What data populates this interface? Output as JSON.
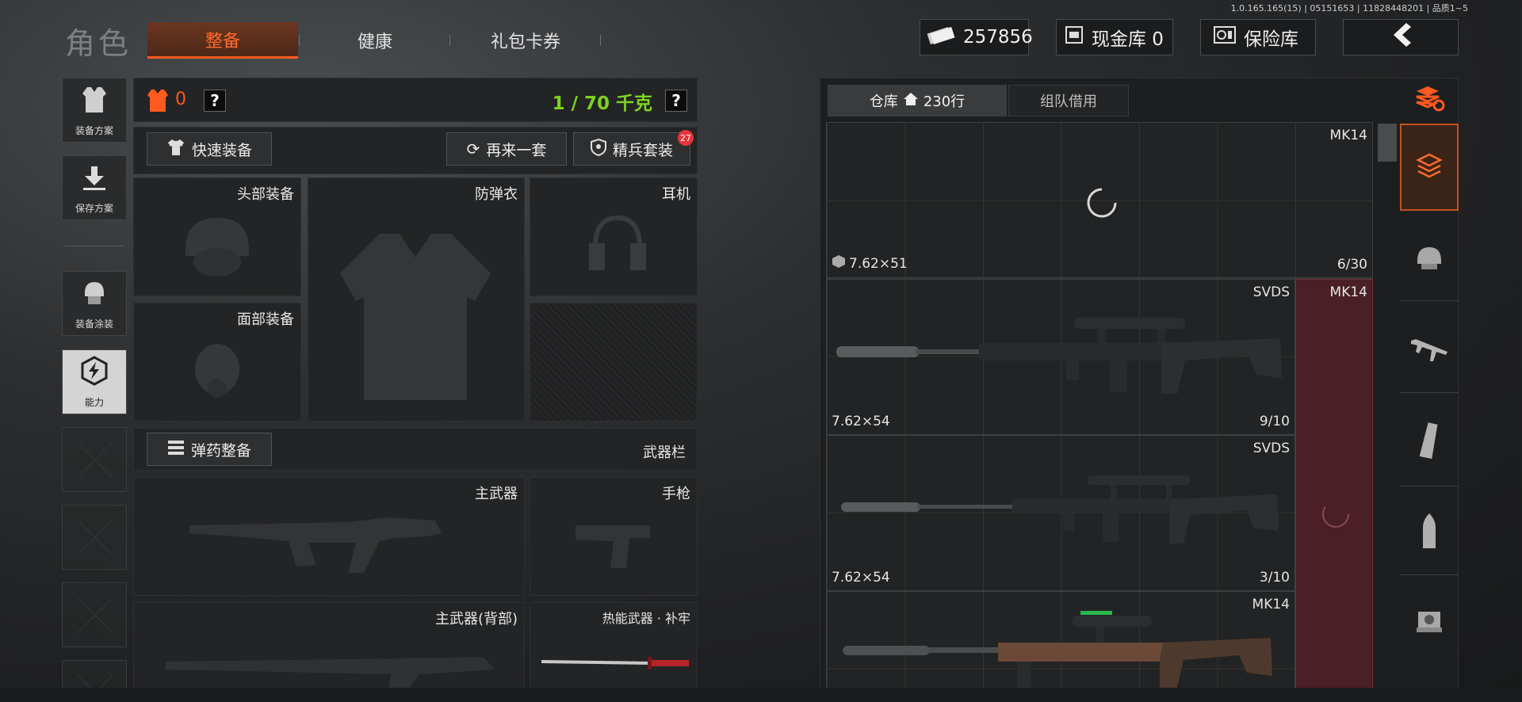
{
  "version": "1.0.165.165(15) | 05151653 | 11828448201 | 品质1~5",
  "header": {
    "title": "角色",
    "tabs": [
      {
        "label": "整备",
        "active": true
      },
      {
        "label": "健康",
        "active": false
      },
      {
        "label": "礼包卡券",
        "active": false
      }
    ],
    "currency": "257856",
    "cash_vault": "现金库 0",
    "safe": "保险库",
    "back_icon": "chevron-left-icon"
  },
  "left_nav": [
    {
      "label": "装备方案",
      "icon": "vest-icon"
    },
    {
      "label": "保存方案",
      "icon": "download-icon"
    },
    {
      "label": "装备涂装",
      "icon": "helmet-paint-icon"
    },
    {
      "label": "能力",
      "icon": "lightning-icon",
      "active": true
    }
  ],
  "loadout": {
    "armor_value": "0",
    "help": "?",
    "weight": "1 / 70 千克",
    "quick_equip": "快速装备",
    "reroll": "再来一套",
    "elite": "精兵套装",
    "elite_badge": "27",
    "slots": {
      "head": "头部装备",
      "vest": "防弹衣",
      "headset": "耳机",
      "face": "面部装备"
    },
    "ammo_btn": "弹药整备",
    "weapon_bar": "武器栏",
    "weapons": {
      "primary": "主武器",
      "pistol": "手枪",
      "primary_back": "主武器(背部)",
      "melee": "热能武器 · 补牢"
    }
  },
  "warehouse": {
    "tab_storage": "仓库",
    "rows": "230行",
    "tab_team": "组队借用",
    "items": [
      {
        "name": "MK14",
        "caliber": "7.62×51",
        "count": "6/30",
        "loading": true
      },
      {
        "name": "SVDS",
        "caliber": "7.62×54",
        "count": "9/10"
      },
      {
        "name": "SVDS",
        "caliber": "7.62×54",
        "count": "3/10"
      },
      {
        "name": "MK14",
        "caliber": "",
        "count": ""
      }
    ],
    "side_name": "MK14"
  },
  "colors": {
    "accent": "#ff5a1f",
    "weight_green": "#7ed321",
    "badge_red": "#e8343a"
  }
}
